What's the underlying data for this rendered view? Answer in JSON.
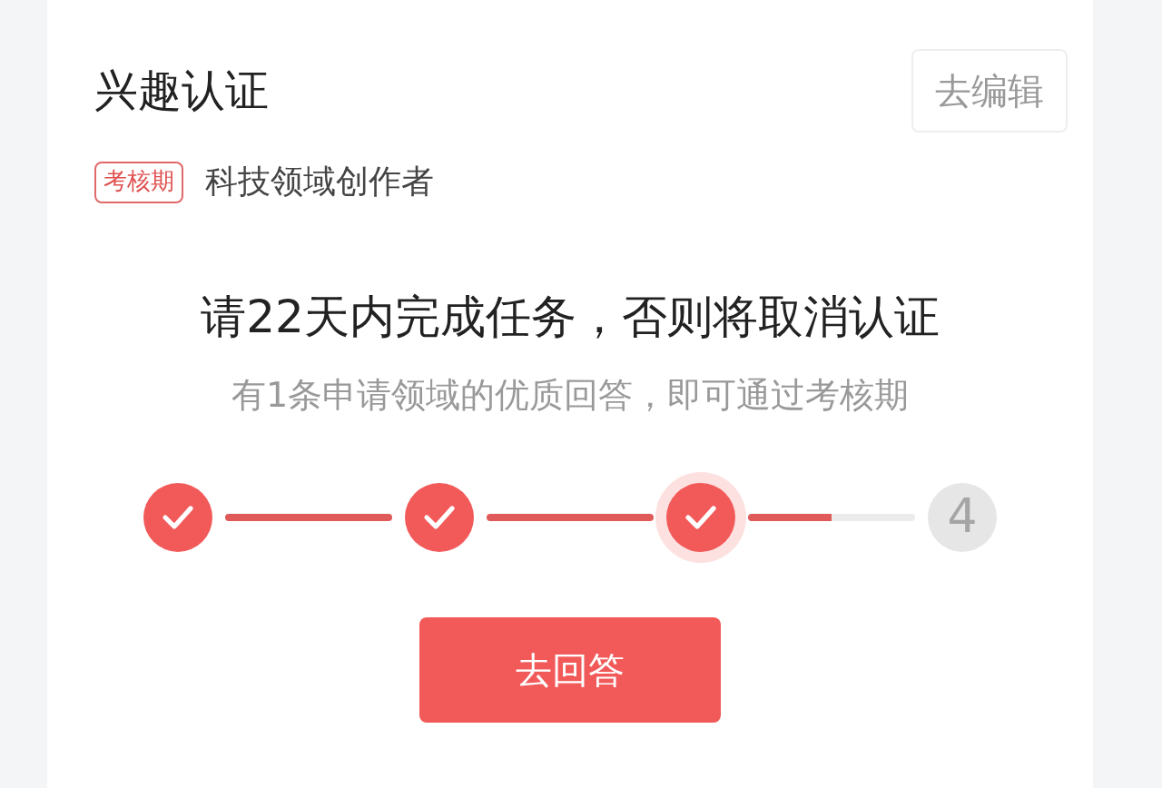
{
  "header": {
    "title": "兴趣认证",
    "edit_button": "去编辑"
  },
  "tag": {
    "label": "考核期",
    "field": "科技领域创作者"
  },
  "headline": "请22天内完成任务，否则将取消认证",
  "subtitle": "有1条申请领域的优质回答，即可通过考核期",
  "steps": [
    {
      "kind": "done"
    },
    {
      "kind": "done"
    },
    {
      "kind": "current"
    },
    {
      "kind": "todo",
      "label": "4"
    }
  ],
  "connectors": [
    {
      "level": 1
    },
    {
      "level": 1
    },
    {
      "level": 0.5
    }
  ],
  "action_button": "去回答"
}
